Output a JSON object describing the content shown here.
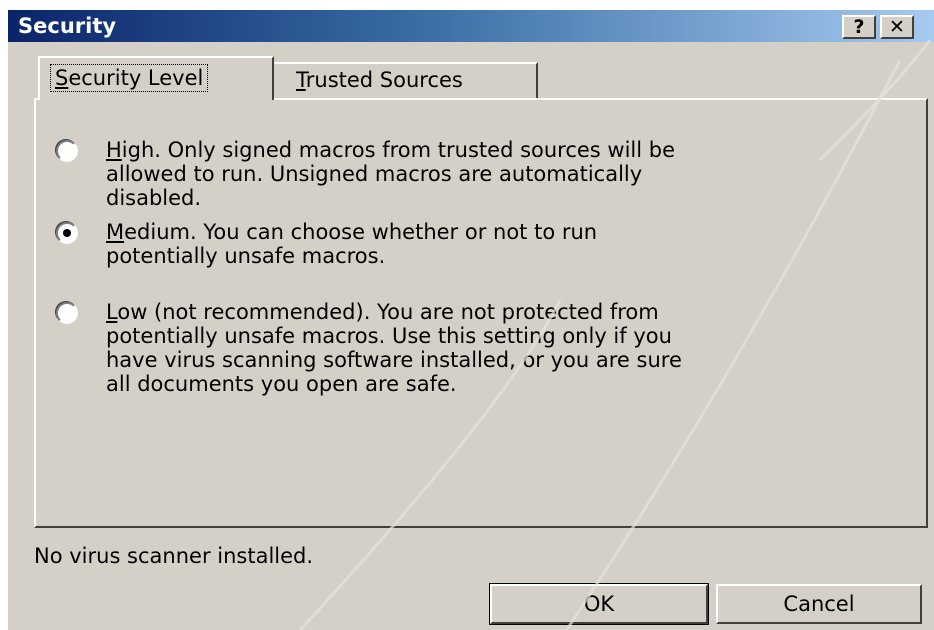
{
  "window": {
    "title": "Security",
    "help_button": "?",
    "close_button": "✕"
  },
  "tabs": [
    {
      "label": "Security Level",
      "selected": true
    },
    {
      "label": "Trusted Sources",
      "selected": false
    }
  ],
  "security_levels": [
    {
      "lines": [
        "High. Only signed macros from trusted sources will be",
        "allowed to run. Unsigned macros are automatically",
        "disabled."
      ],
      "checked": false
    },
    {
      "lines": [
        "Medium. You can choose whether or not to run",
        "potentially unsafe macros."
      ],
      "checked": true
    },
    {
      "lines": [
        "Low (not recommended). You are not protected from",
        "potentially unsafe macros. Use this setting only if you",
        "have virus scanning software installed, or you are sure",
        "all documents you open are safe."
      ],
      "checked": false
    }
  ],
  "status_text": "No virus scanner installed.",
  "buttons": {
    "ok_label": "OK",
    "cancel_label": "Cancel"
  },
  "colors": {
    "title_start": "#0a246a",
    "title_end": "#a6caf0",
    "dialog_face": "#d4d0c8"
  }
}
